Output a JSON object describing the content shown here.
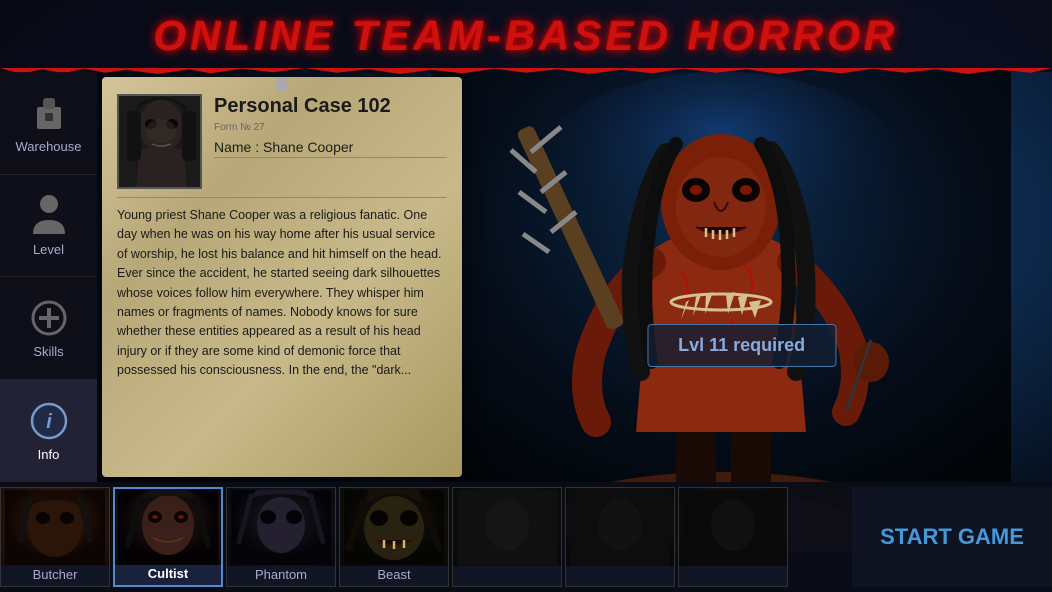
{
  "header": {
    "title": "ONLINE TEAM-BASED HORROR"
  },
  "sidebar": {
    "items": [
      {
        "id": "warehouse",
        "label": "Warehouse",
        "active": false
      },
      {
        "id": "level",
        "label": "Level",
        "active": false
      },
      {
        "id": "skills",
        "label": "Skills",
        "active": false
      },
      {
        "id": "info",
        "label": "Info",
        "active": true
      }
    ]
  },
  "case_card": {
    "title": "Personal Case 102",
    "form_number": "Form № 27",
    "name_label": "Name : Shane Cooper",
    "body_text": "Young priest Shane Cooper was a religious fanatic. One day when he was on his way home after his usual service of worship, he lost his balance and hit himself on the head. Ever since the accident, he started seeing dark silhouettes whose voices follow him everywhere. They whisper him names or fragments of names. Nobody knows for sure whether these entities appeared as a result of his head injury or if they are some kind of demonic force that possessed his consciousness. In the end, the \"dark..."
  },
  "monster": {
    "lvl_badge": "Lvl 11 required"
  },
  "bottom_bar": {
    "characters": [
      {
        "id": "butcher",
        "label": "Butcher",
        "active": false
      },
      {
        "id": "cultist",
        "label": "Cultist",
        "active": true
      },
      {
        "id": "phantom",
        "label": "Phantom",
        "active": false
      },
      {
        "id": "beast",
        "label": "Beast",
        "active": false
      },
      {
        "id": "locked1",
        "label": "",
        "active": false
      },
      {
        "id": "locked2",
        "label": "",
        "active": false
      },
      {
        "id": "locked3",
        "label": "",
        "active": false
      }
    ],
    "start_button": "START GAME"
  }
}
